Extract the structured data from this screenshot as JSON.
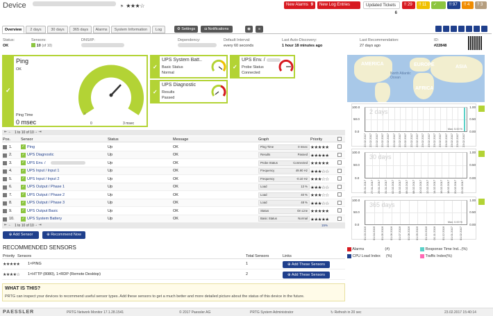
{
  "header": {
    "title": "Device",
    "stars": "★★★☆",
    "badges": [
      {
        "label": "New Alarms",
        "count": "9",
        "color": "#d71920"
      },
      {
        "label": "New Log Entries",
        "count": "6128",
        "color": "#d71920"
      },
      {
        "label": "Updated Tickets",
        "count": "6",
        "color": "#ffffff"
      }
    ],
    "counters": [
      {
        "label": "!! 29",
        "color": "#d71920"
      },
      {
        "label": "!! 11",
        "color": "#f0c000"
      },
      {
        "label": "✓ 273",
        "color": "#8cc540"
      },
      {
        "label": "!! 97",
        "color": "#1f3f8c"
      },
      {
        "label": "!! 4",
        "color": "#f08c00"
      },
      {
        "label": "? 3",
        "color": "#b59e7f"
      }
    ]
  },
  "tabs": [
    "Overview",
    "2 days",
    "30 days",
    "365 days",
    "Alarms",
    "System Information",
    "Log"
  ],
  "toolbar": {
    "settings": "Settings",
    "notifications": "Notifications"
  },
  "info": {
    "status_label": "Status:",
    "status_value": "OK",
    "sensors_label": "Sensors:",
    "sensors_value": "10",
    "sensors_of": "(of 10)",
    "dns_label": "DNS/IP:",
    "dependency_label": "Dependency:",
    "interval_label": "Default Interval:",
    "interval_value": "every 60 seconds",
    "discovery_label": "Last Auto-Discovery:",
    "discovery_value": "1 hour 18 minutes ago",
    "recommendation_label": "Last Recommendation:",
    "recommendation_value": "27 days ago",
    "id_label": "ID:",
    "id_value": "#22848"
  },
  "ping_card": {
    "title": "Ping",
    "status": "OK",
    "footer_label": "Ping Time",
    "footer_value": "0 msec",
    "gauge_min": "0",
    "gauge_max": "3 msec",
    "tick": "1"
  },
  "small_cards": [
    {
      "title": "UPS System Batt..",
      "line1": "Basic Status",
      "line2": "Normal"
    },
    {
      "title": "UPS Env. /",
      "line1": "Probe Status",
      "line2": "Connected"
    },
    {
      "title": "UPS Diagnostic",
      "line1": "Results",
      "line2": "Passed"
    }
  ],
  "table": {
    "pager_top": "1 to 10 of 10",
    "pager_bottom": "1 to 10 of 10",
    "headers": [
      "Pos.",
      "Sensor",
      "Status",
      "Message",
      "Graph",
      "Priority"
    ],
    "rows": [
      {
        "pos": "1.",
        "sensor": "Ping",
        "status": "Up",
        "message": "OK",
        "graph_label": "Ping Time",
        "graph_value": "0 msec",
        "stars": "★★★★★"
      },
      {
        "pos": "2.",
        "sensor": "UPS Diagnostic",
        "status": "Up",
        "message": "OK",
        "graph_label": "Results",
        "graph_value": "Passed",
        "stars": "★★★★★"
      },
      {
        "pos": "3.",
        "sensor": "UPS Env. /",
        "status": "Up",
        "message": "OK",
        "graph_label": "Probe Status",
        "graph_value": "Connected",
        "stars": "★★★★★"
      },
      {
        "pos": "4.",
        "sensor": "UPS Input / Input 1",
        "status": "Up",
        "message": "OK",
        "graph_label": "Frequency",
        "graph_value": "49.90 Hz",
        "stars": "★★★☆☆"
      },
      {
        "pos": "5.",
        "sensor": "UPS Input / Input 2",
        "status": "Up",
        "message": "OK",
        "graph_label": "Frequency",
        "graph_value": "-0.10 Hz",
        "stars": "★★★☆☆"
      },
      {
        "pos": "6.",
        "sensor": "UPS Output / Phase 1",
        "status": "Up",
        "message": "OK",
        "graph_label": "Load",
        "graph_value": "13 %",
        "stars": "★★★☆☆"
      },
      {
        "pos": "7.",
        "sensor": "UPS Output / Phase 2",
        "status": "Up",
        "message": "OK",
        "graph_label": "Load",
        "graph_value": "40 %",
        "stars": "★★★☆☆"
      },
      {
        "pos": "8.",
        "sensor": "UPS Output / Phase 3",
        "status": "Up",
        "message": "OK",
        "graph_label": "Load",
        "graph_value": "48 %",
        "stars": "★★★☆☆"
      },
      {
        "pos": "9.",
        "sensor": "UPS Output Basic",
        "status": "Up",
        "message": "OK",
        "graph_label": "Status",
        "graph_value": "On Line",
        "stars": "★★★★★"
      },
      {
        "pos": "10.",
        "sensor": "UPS System Battery",
        "status": "Up",
        "message": "OK",
        "graph_label": "Basic Status",
        "graph_value": "Normal",
        "stars": "★★★★★"
      }
    ],
    "percent": "15%"
  },
  "actions": {
    "add_sensor": "Add Sensor",
    "recommend_now": "Recommend Now"
  },
  "recommended": {
    "title": "RECOMMENDED SENSORS",
    "headers": [
      "Priority",
      "Sensors",
      "Total Sensors",
      "Links"
    ],
    "rows": [
      {
        "stars": "★★★★★",
        "sensors": "1×PING",
        "total": "1",
        "button": "Add These Sensors"
      },
      {
        "stars": "★★★★☆",
        "sensors": "1×HTTP (8080), 1×RDP (Remote Desktop)",
        "total": "2",
        "button": "Add These Sensors"
      }
    ]
  },
  "whatis": {
    "title": "WHAT IS THIS?",
    "text": "PRTG can inspect your devices to recommend useful sensor types. Add these sensors to get a much better and more detailed picture about the status of this device in the future."
  },
  "map_labels": [
    "AMERICA",
    "EUROPE",
    "ASIA",
    "AFRICA",
    "North Atlantic Ocean"
  ],
  "charts": [
    {
      "title": "2 days",
      "ymax": "100.0",
      "ymid": "50.0",
      "ymin": "0.0",
      "right_top": "1.00",
      "right_mid": "0.50",
      "right_bot": "0.00",
      "maxnote": "Max: 5.00 %",
      "dates": [
        "22.02.2017",
        "22.02.2017",
        "22.02.2017",
        "22.02.2017",
        "22.02.2017",
        "22.02.2017",
        "22.02.2017",
        "22.02.2017",
        "22.02.2017",
        "22.02.2017",
        "23.02.2017",
        "23.02.2017",
        "23.02.2017",
        "23.02.2017",
        "23.02.2017",
        "23.02.2017",
        "23.02.2017",
        "23.02.2017"
      ]
    },
    {
      "title": "30 days",
      "ymax": "100.0",
      "ymid": "50.0",
      "ymin": "0.0",
      "right_top": "1.00",
      "right_mid": "0.50",
      "right_bot": "0.00",
      "maxnote": "",
      "dates": [
        "25.01.2017",
        "27.01.2017",
        "29.01.2017",
        "31.01.2017",
        "02.02.2017",
        "04.02.2017",
        "06.02.2017",
        "08.02.2017",
        "10.02.2017",
        "12.02.2017",
        "14.02.2017",
        "16.02.2017",
        "18.02.2017",
        "20.02.2017",
        "22.02.2017"
      ]
    },
    {
      "title": "365 days",
      "ymax": "100.0",
      "ymid": "50.0",
      "ymin": "0.0",
      "right_top": "1.00",
      "right_mid": "0.50",
      "right_bot": "0.00",
      "maxnote": "Max: 0.00 %",
      "dates": [
        "01.03.2016",
        "01.04.2016",
        "01.05.2016",
        "01.06.2016",
        "01.07.2016",
        "01.08.2016",
        "01.09.2016",
        "01.10.2016",
        "01.11.2016",
        "01.12.2016",
        "01.01.2017",
        "01.02.2017"
      ]
    }
  ],
  "legend": [
    {
      "label": "Alarms",
      "unit": "(#)",
      "color": "#d71920"
    },
    {
      "label": "Response Time Ind...",
      "unit": "(%)",
      "color": "#5ad1c8"
    },
    {
      "label": "CPU Load Index",
      "unit": "(%)",
      "color": "#1f3f8c"
    },
    {
      "label": "Traffic Index",
      "unit": "(%)",
      "color": "#ff69b4"
    }
  ],
  "footer": {
    "brand": "PAESSLER",
    "version": "PRTG Network Monitor 17.1.28.1541",
    "copyright": "© 2017 Paessler AG",
    "user": "PRTG System Administrator",
    "refresh": "Refresh in 20 sec",
    "datetime": "23.02.2017 15:40:14"
  }
}
